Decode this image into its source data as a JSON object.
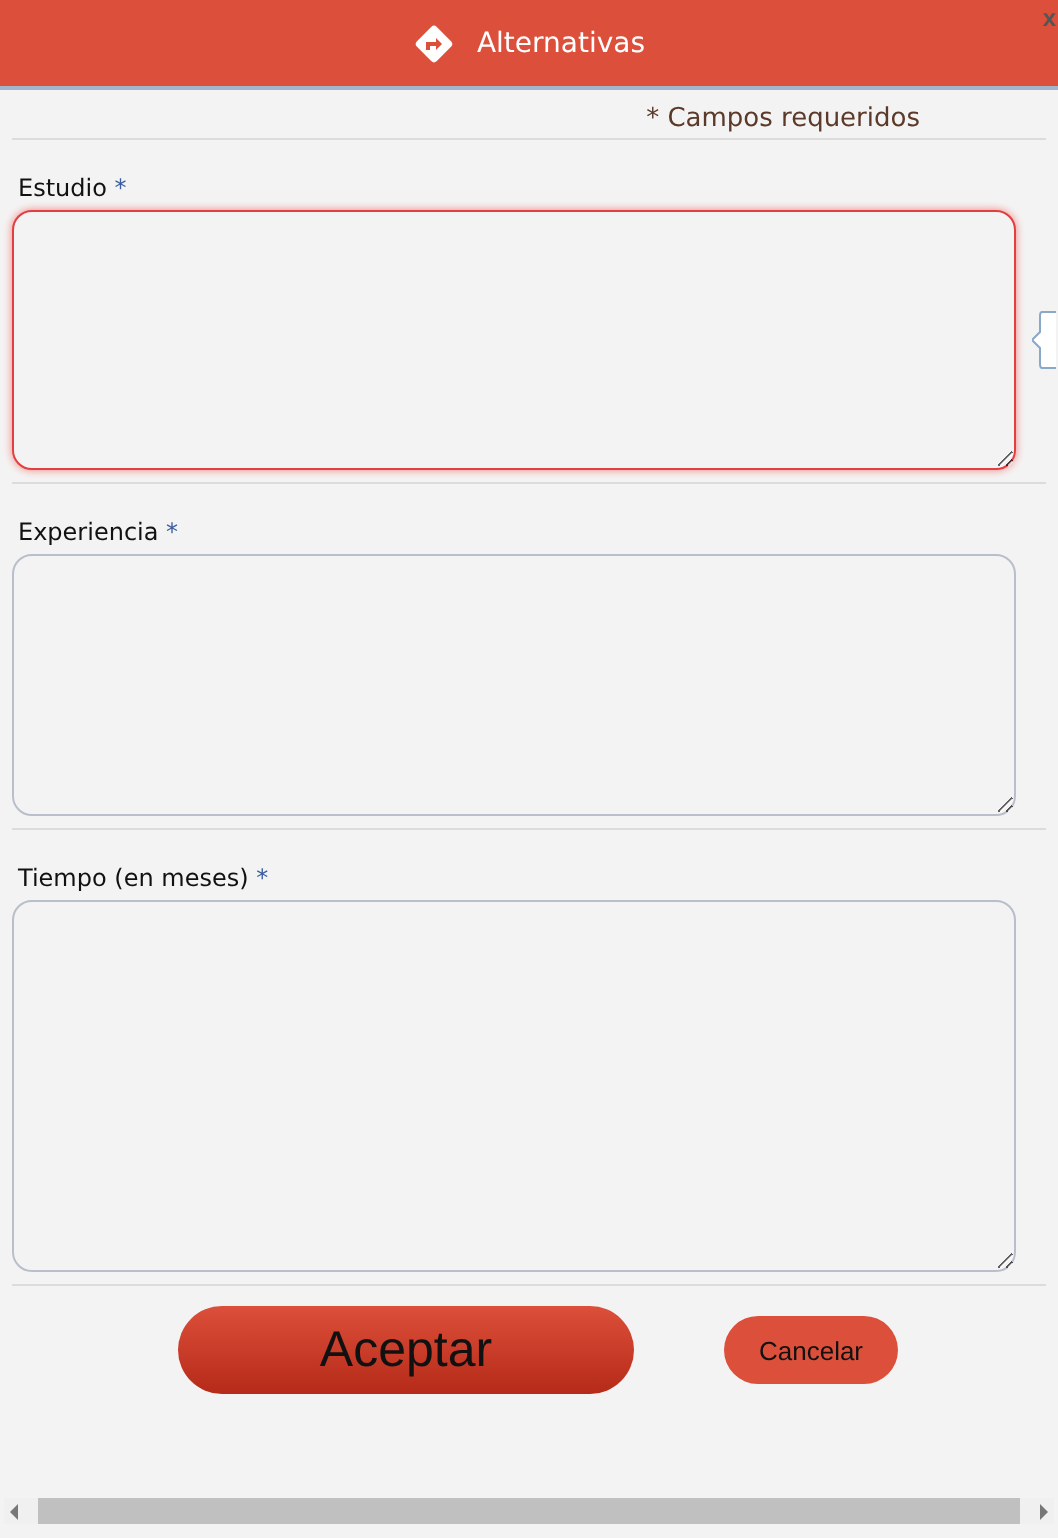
{
  "dialog": {
    "title": "Alternativas",
    "close": "x"
  },
  "required_note": {
    "mark": "*",
    "text": "Campos requeridos"
  },
  "fields": [
    {
      "label": "Estudio",
      "mark": "*",
      "focused": true
    },
    {
      "label": "Experiencia",
      "mark": "*",
      "focused": false
    },
    {
      "label": "Tiempo (en meses)",
      "mark": "*",
      "focused": false
    }
  ],
  "buttons": [
    {
      "label": "Aceptar",
      "kind": "primary"
    },
    {
      "label": "Cancelar",
      "kind": "secondary"
    }
  ]
}
